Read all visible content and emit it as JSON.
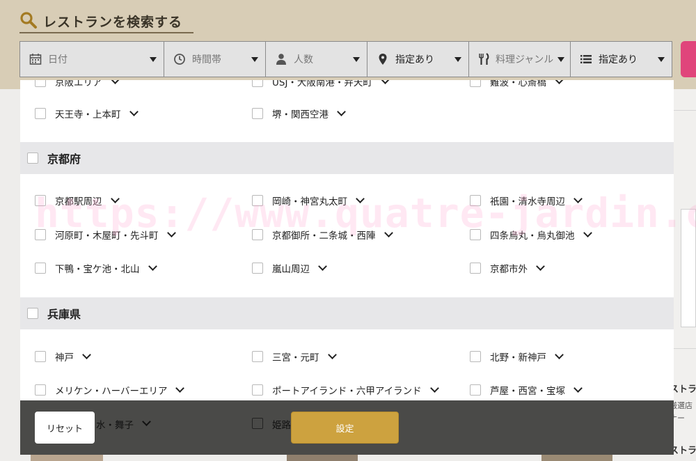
{
  "header": {
    "title": "レストランを検索する",
    "filters": [
      {
        "icon": "calendar-icon",
        "label": "日付",
        "dark": false,
        "width": 208
      },
      {
        "icon": "clock-icon",
        "label": "時間帯",
        "dark": false,
        "width": 146
      },
      {
        "icon": "person-icon",
        "label": "人数",
        "dark": false,
        "width": 146
      },
      {
        "icon": "location-pin-icon",
        "label": "指定あり",
        "dark": true,
        "width": 146
      },
      {
        "icon": "fork-knife-icon",
        "label": "料理ジャンル",
        "dark": false,
        "width": 146
      },
      {
        "icon": "list-icon",
        "label": "指定あり",
        "dark": true,
        "width": 146
      }
    ]
  },
  "areas": {
    "osaka_partial_top": [
      "京阪エリア",
      "USJ・大阪南港・弁天町",
      "難波・心斎橋"
    ],
    "osaka_last_row": [
      "天王寺・上本町",
      "堺・関西空港"
    ],
    "kyoto": {
      "name": "京都府",
      "items": [
        "京都駅周辺",
        "岡崎・神宮丸太町",
        "祇園・清水寺周辺",
        "河原町・木屋町・先斗町",
        "京都御所・二条城・西陣",
        "四条烏丸・烏丸御池",
        "下鴨・宝ケ池・北山",
        "嵐山周辺",
        "京都市外"
      ]
    },
    "hyogo": {
      "name": "兵庫県",
      "items": [
        "神戸",
        "三宮・元町",
        "北野・新神戸",
        "メリケン・ハーバーエリア",
        "ポートアイランド・六甲アイランド",
        "芦屋・西宮・宝塚"
      ],
      "partial_bottom": [
        "水・舞子",
        "姫路"
      ]
    }
  },
  "watermark": "https://www.quatre-jardin.com",
  "footer": {
    "reset_label": "リセット",
    "set_label": "設定"
  },
  "background": {
    "right_texts": [
      "ストラン",
      "厳選店",
      "ナー",
      "ストラ"
    ]
  },
  "colors": {
    "header_bg": "#d8cdb6",
    "set_button": "#cda23f",
    "accent_pink": "#e0457b",
    "footer_bg": "#4a4a48"
  }
}
